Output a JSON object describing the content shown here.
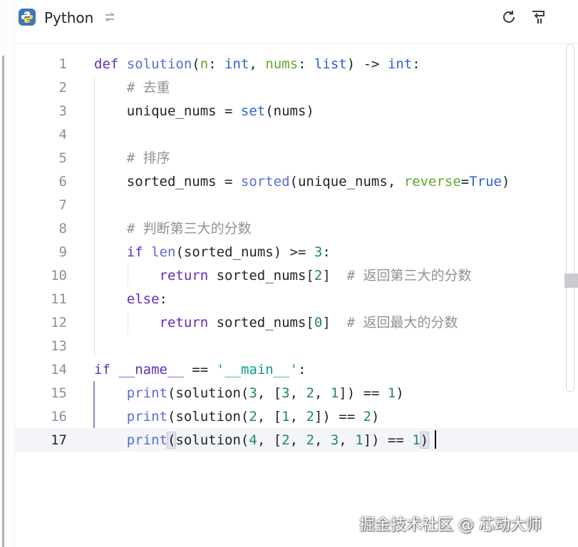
{
  "toolbar": {
    "language": "Python",
    "icons": {
      "language": "python-logo-icon",
      "switch": "switch-language-icon",
      "reset": "reset-icon",
      "wrap": "word-wrap-icon"
    }
  },
  "editor": {
    "line_numbers": [
      "1",
      "2",
      "3",
      "4",
      "5",
      "6",
      "7",
      "8",
      "9",
      "10",
      "11",
      "12",
      "13",
      "14",
      "15",
      "16",
      "17"
    ],
    "active_line": "17",
    "comments": {
      "dedup": "# 去重",
      "sort": "# 排序",
      "judge": "# 判断第三大的分数",
      "return_third": "# 返回第三大的分数",
      "return_max": "# 返回最大的分数"
    }
  },
  "watermark": "掘金技术社区 @ 芯动大师",
  "colors": {
    "keyword": "#5e2cbf",
    "function": "#5b6bd5",
    "builtin": "#2a62d6",
    "number": "#1c8a5b",
    "string": "#0d9a8f",
    "comment": "#8e9199"
  }
}
